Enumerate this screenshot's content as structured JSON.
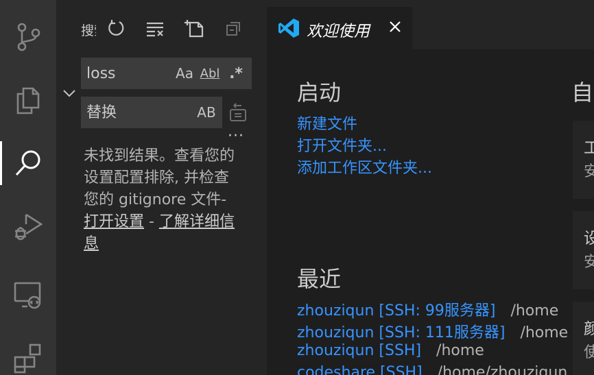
{
  "activity_bar": {
    "items": [
      {
        "name": "source-control",
        "icon": "source-control-icon",
        "active": false
      },
      {
        "name": "explorer",
        "icon": "files-icon",
        "active": false
      },
      {
        "name": "search",
        "icon": "search-icon",
        "active": true
      },
      {
        "name": "run-debug",
        "icon": "run-debug-icon",
        "active": false
      },
      {
        "name": "remote-explorer",
        "icon": "remote-explorer-icon",
        "active": false
      },
      {
        "name": "extensions",
        "icon": "extensions-icon",
        "active": false
      }
    ]
  },
  "sidebar": {
    "title": "搜索",
    "actions": [
      "refresh-icon",
      "clear-results-icon",
      "new-search-editor-icon",
      "collapse-all-icon"
    ],
    "search": {
      "value": "loss",
      "options": {
        "match_case": "Aa",
        "whole_word": "Abl",
        "regex": ".*"
      }
    },
    "replace": {
      "placeholder": "替换",
      "preserve_case": "AB"
    },
    "more": "···",
    "message": {
      "text": "未找到结果。查看您的设置配置排除, 并检查您的 gitignore 文件-",
      "open_settings": "打开设置",
      "sep": " - ",
      "learn_more": "了解详细信息"
    }
  },
  "tab": {
    "label": "欢迎使用"
  },
  "welcome": {
    "start": {
      "title": "启动",
      "links": [
        "新建文件",
        "打开文件夹...",
        "添加工作区文件夹..."
      ]
    },
    "recent": {
      "title": "最近",
      "items": [
        {
          "name": "zhouziqun [SSH: 99服务器]",
          "path": "/home"
        },
        {
          "name": "zhouziqun [SSH: 111服务器]",
          "path": "/home"
        },
        {
          "name": "zhouziqun [SSH]",
          "path": "/home"
        },
        {
          "name": "codeshare [SSH]",
          "path": "/home/zhouziqun"
        }
      ]
    },
    "right_column": {
      "title": "自",
      "cards": [
        {
          "title": "工",
          "subtitle": "安"
        },
        {
          "title": "设",
          "subtitle": "安"
        },
        {
          "title": "颜",
          "subtitle": "使"
        }
      ]
    }
  },
  "colors": {
    "activity_bar": "#333333",
    "sidebar": "#252526",
    "editor": "#1e1e1e",
    "link": "#3794ff",
    "vscode_blue": "#23a9f2"
  }
}
